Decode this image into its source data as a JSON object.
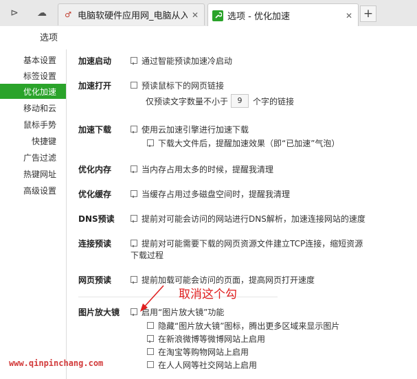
{
  "tabbar": {
    "tabs": [
      {
        "title": "电脑软硬件应用网_电脑从入门",
        "close": "✕",
        "favicon_color": "#ffffff",
        "favicon_text": "♂"
      },
      {
        "title": "选项 - 优化加速",
        "close": "✕",
        "favicon_color": "#2aa32a",
        "favicon_text": "🔧"
      }
    ],
    "newtab": "+",
    "sidebar_toggle_icon": "⊳",
    "cloud_icon": "☁"
  },
  "page": {
    "title": "选项"
  },
  "sidebar": {
    "items": [
      {
        "label": "基本设置"
      },
      {
        "label": "标签设置"
      },
      {
        "label": "优化加速"
      },
      {
        "label": "移动和云"
      },
      {
        "label": "鼠标手势"
      },
      {
        "label": "快捷键"
      },
      {
        "label": "广告过滤"
      },
      {
        "label": "热键网址"
      },
      {
        "label": "高级设置"
      }
    ],
    "active_index": 2
  },
  "sections": {
    "startup": {
      "label": "加速启动",
      "option": "通过智能预读加速冷启动"
    },
    "open": {
      "label": "加速打开",
      "option": "预读鼠标下的网页链接",
      "sub_prefix": "仅预读文字数量不小于",
      "sub_value": "9",
      "sub_suffix": "个字的链接"
    },
    "download": {
      "label": "加速下载",
      "option": "使用云加速引擎进行加速下载",
      "sub": "下载大文件后，提醒加速效果（即“已加速”气泡）"
    },
    "memory": {
      "label": "优化内存",
      "option": "当内存占用太多的时候，提醒我清理"
    },
    "cache": {
      "label": "优化缓存",
      "option": "当缓存占用过多磁盘空间时，提醒我清理"
    },
    "dns": {
      "label": "DNS预读",
      "option": "提前对可能会访问的网站进行DNS解析，加速连接网站的速度"
    },
    "connect": {
      "label": "连接预读",
      "option_line1": "提前对可能需要下载的网页资源文件建立TCP连接，缩短资源",
      "option_line2": "下载过程"
    },
    "webpage": {
      "label": "网页预读",
      "option": "提前加载可能会访问的页面，提高网页打开速度"
    },
    "magnifier": {
      "label": "图片放大镜",
      "option": "启用“图片放大镜”功能",
      "subs": [
        "隐藏“图片放大镜”图标，腾出更多区域来显示图片",
        "在新浪微博等微博网站上启用",
        "在淘宝等购物网站上启用",
        "在人人网等社交网站上启用"
      ]
    }
  },
  "annotation": {
    "text": "取消这个勾",
    "color": "#e02020"
  },
  "watermark": {
    "text": "www.qinpinchang.com"
  },
  "colors": {
    "accent": "#2aa32a",
    "annotation": "#e02020",
    "watermark": "#d23a3a"
  }
}
